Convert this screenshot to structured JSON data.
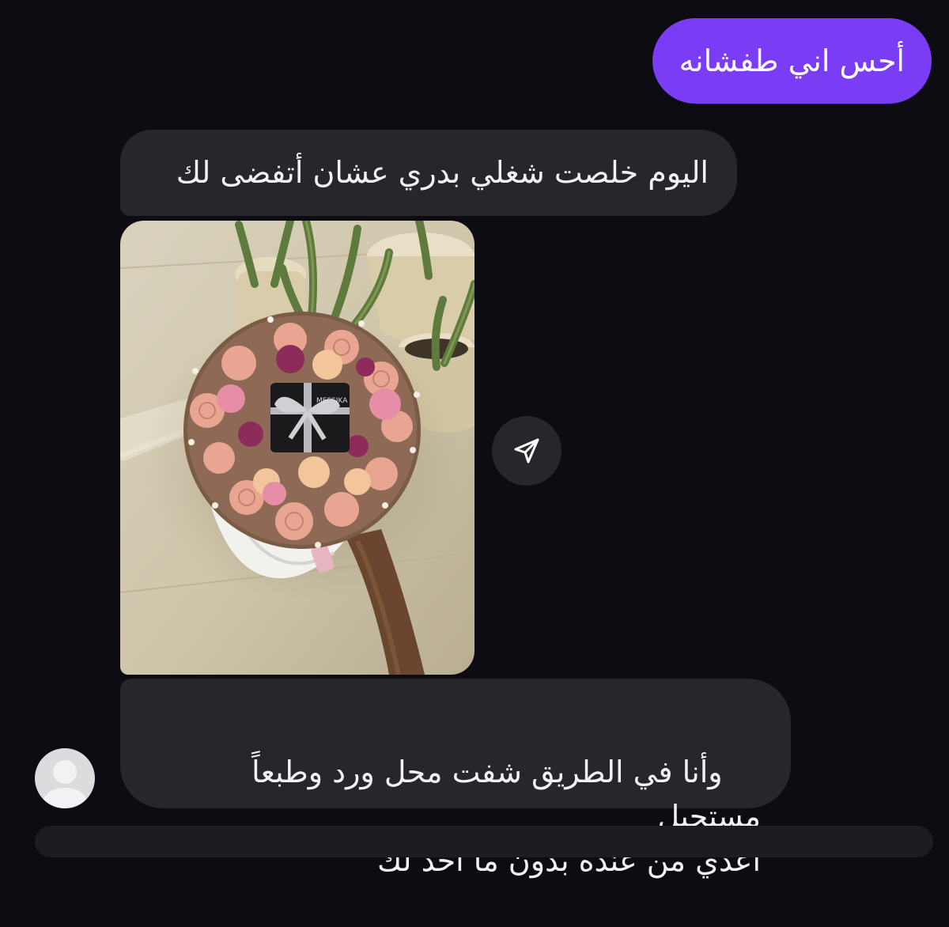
{
  "messages": [
    {
      "direction": "sent",
      "text": "أحس اني طفشانه"
    },
    {
      "direction": "received",
      "text": "اليوم خلصت شغلي بدري عشان أتفضى لك"
    },
    {
      "direction": "received",
      "type": "image",
      "caption": "",
      "brand_text_on_box": "MESSIKA"
    },
    {
      "direction": "received",
      "text": "وأنا في الطريق شفت محل ورد وطبعاً مستحيل\nأعدي من عنده بدون ما أخذ لك"
    }
  ],
  "icons": {
    "share": "send-paper-plane-icon",
    "avatar": "default-person-avatar-icon"
  },
  "colors": {
    "background": "#0c0c12",
    "sent_bubble": "#7b3cf6",
    "received_bubble": "#26262b",
    "text": "#f2f2f4"
  }
}
